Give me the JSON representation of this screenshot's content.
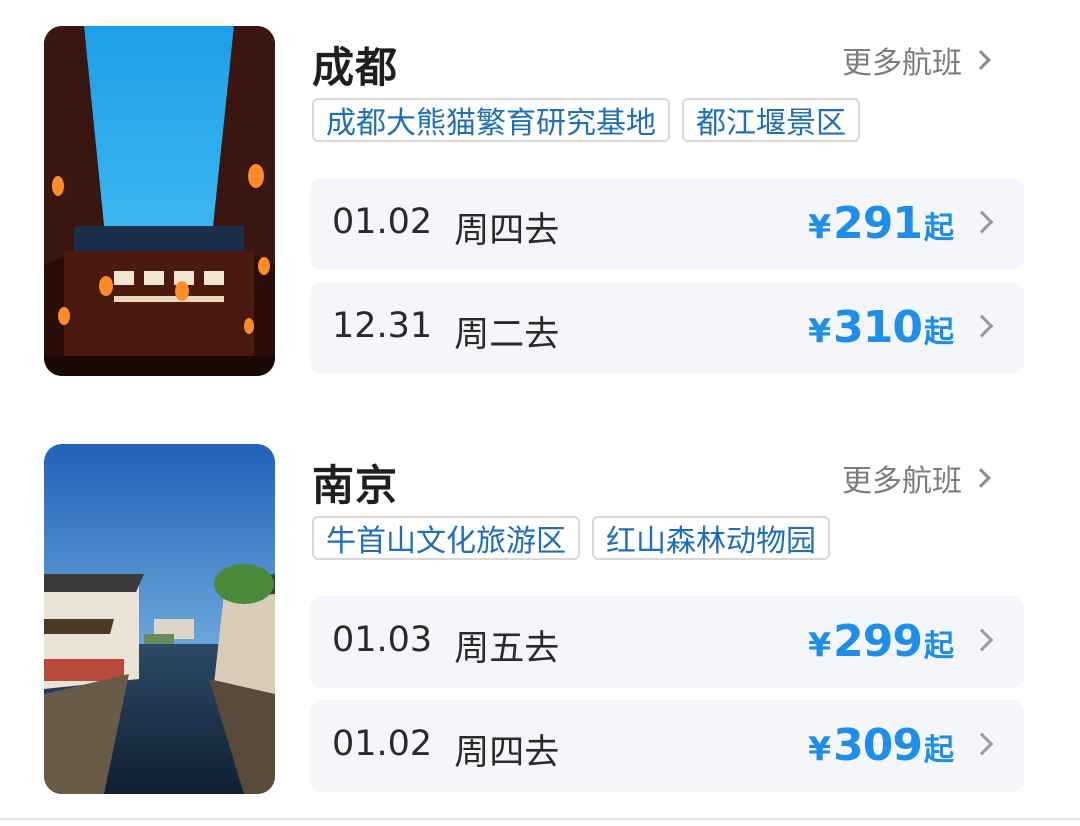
{
  "cards": [
    {
      "city": "成都",
      "more_label": "更多航班",
      "tags": [
        "成都大熊猫繁育研究基地",
        "都江堰景区"
      ],
      "flights": [
        {
          "date": "01.02",
          "day": "周四去",
          "currency": "¥",
          "price": "291",
          "suffix": "起"
        },
        {
          "date": "12.31",
          "day": "周二去",
          "currency": "¥",
          "price": "310",
          "suffix": "起"
        }
      ],
      "image": "chengdu-ancient-street-lanterns"
    },
    {
      "city": "南京",
      "more_label": "更多航班",
      "tags": [
        "牛首山文化旅游区",
        "红山森林动物园"
      ],
      "flights": [
        {
          "date": "01.03",
          "day": "周五去",
          "currency": "¥",
          "price": "299",
          "suffix": "起"
        },
        {
          "date": "01.02",
          "day": "周四去",
          "currency": "¥",
          "price": "309",
          "suffix": "起"
        }
      ],
      "image": "water-town-canal"
    }
  ],
  "colors": {
    "accent_price": "#1e8ee8",
    "tag_text": "#1f6fb8",
    "row_bg": "#f4f6f9"
  }
}
